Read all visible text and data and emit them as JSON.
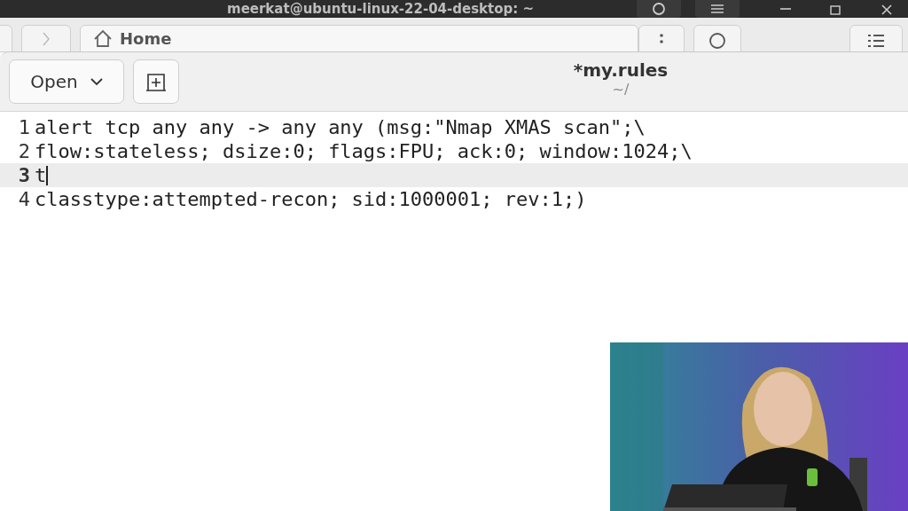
{
  "terminal_bar": {
    "title": "meerkat@ubuntu-linux-22-04-desktop: ~"
  },
  "files_bar": {
    "location": "Home"
  },
  "editor": {
    "open_button": "Open",
    "title": "*my.rules",
    "subtitle": "~/",
    "lines": [
      {
        "number": "1",
        "text": "alert tcp any any -> any any (msg:\"Nmap XMAS scan\";\\",
        "current": false
      },
      {
        "number": "2",
        "text": "flow:stateless; dsize:0; flags:FPU; ack:0; window:1024;\\",
        "current": false
      },
      {
        "number": "3",
        "text": "t",
        "current": true
      },
      {
        "number": "4",
        "text": "classtype:attempted-recon; sid:1000001; rev:1;)",
        "current": false
      }
    ]
  }
}
